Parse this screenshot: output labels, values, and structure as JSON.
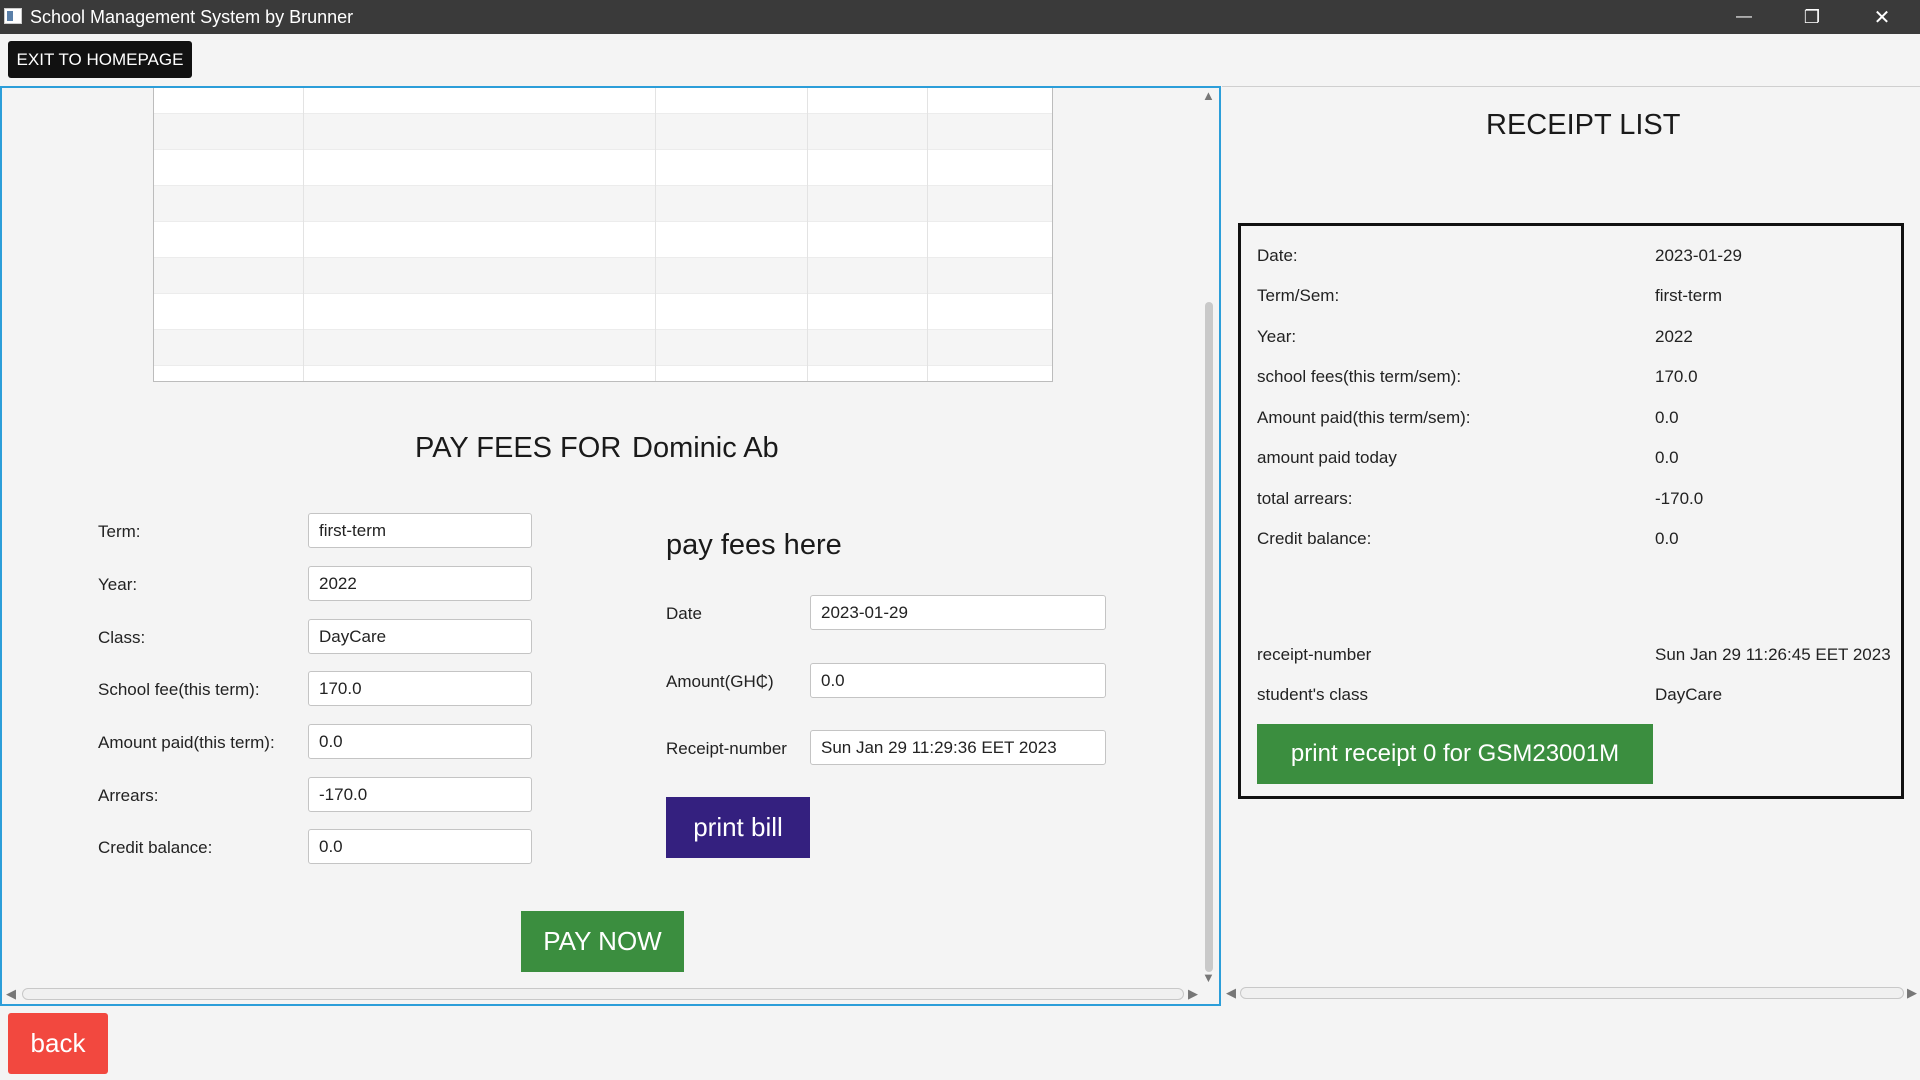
{
  "window": {
    "title": "School Management System by Brunner",
    "minimize_glyph": "—",
    "maximize_glyph": "❐",
    "close_glyph": "✕"
  },
  "toolbar": {
    "exit_label": "EXIT TO HOMEPAGE"
  },
  "form": {
    "title": "PAY FEES FOR",
    "student_name": "Dominic Ab",
    "fields": [
      {
        "label": "Term:",
        "value": "first-term"
      },
      {
        "label": "Year:",
        "value": "2022"
      },
      {
        "label": "Class:",
        "value": "DayCare"
      },
      {
        "label": "School fee(this term):",
        "value": "170.0"
      },
      {
        "label": "Amount paid(this term):",
        "value": "0.0"
      },
      {
        "label": "Arrears:",
        "value": "-170.0"
      },
      {
        "label": "Credit balance:",
        "value": "0.0"
      }
    ],
    "pay_section": {
      "heading": "pay fees here",
      "date_label": "Date",
      "date_value": "2023-01-29",
      "amount_label": "Amount(GH₵)",
      "amount_value": "0.0",
      "receipt_label": "Receipt-number",
      "receipt_value": "Sun Jan 29 11:29:36 EET 2023",
      "print_bill_label": "print bill"
    },
    "pay_now_label": "PAY NOW"
  },
  "receipt_list": {
    "title": "RECEIPT LIST",
    "rows": [
      {
        "label": "Date:",
        "value": "2023-01-29"
      },
      {
        "label": "Term/Sem:",
        "value": "first-term"
      },
      {
        "label": "Year:",
        "value": "2022"
      },
      {
        "label": "school fees(this term/sem):",
        "value": "170.0"
      },
      {
        "label": "Amount paid(this term/sem):",
        "value": "0.0"
      },
      {
        "label": "amount paid today",
        "value": "0.0"
      },
      {
        "label": "total arrears:",
        "value": "-170.0"
      },
      {
        "label": "Credit balance:",
        "value": "0.0"
      }
    ],
    "extra_rows": [
      {
        "label": "receipt-number",
        "value": "Sun Jan 29 11:26:45 EET 2023"
      },
      {
        "label": "student's class",
        "value": "DayCare"
      }
    ],
    "print_receipt_label": "print receipt 0 for GSM23001M"
  },
  "footer": {
    "back_label": "back"
  },
  "colors": {
    "green": "#3b8e3f",
    "purple": "#34207f",
    "red": "#f2483f",
    "focus_border": "#2c9ed9"
  }
}
